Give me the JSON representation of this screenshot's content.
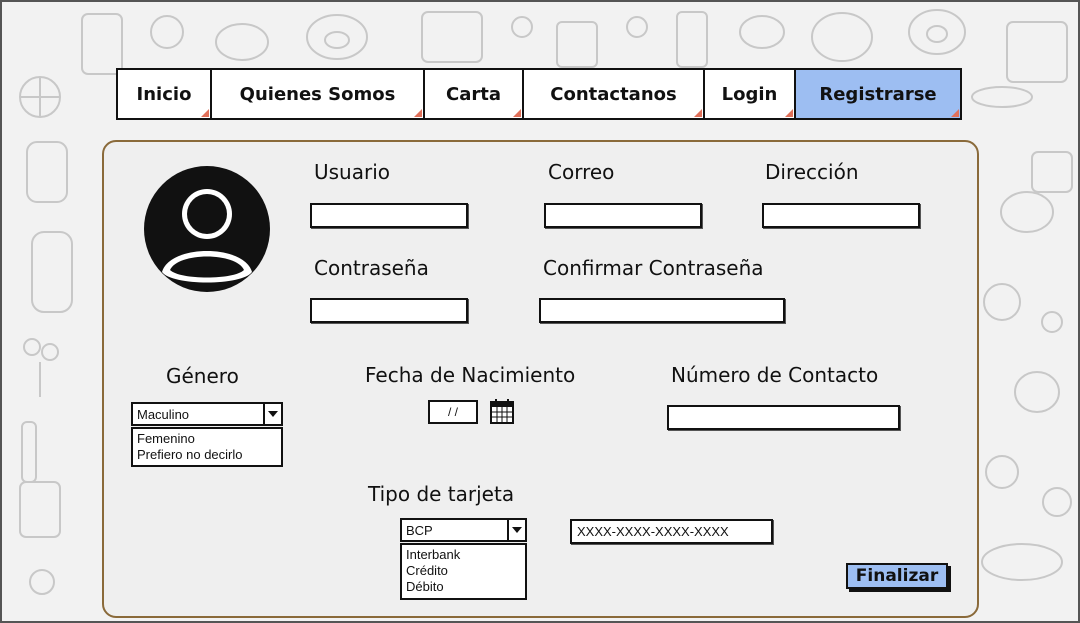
{
  "nav": {
    "items": [
      {
        "label": "Inicio"
      },
      {
        "label": "Quienes Somos"
      },
      {
        "label": "Carta"
      },
      {
        "label": "Contactanos"
      },
      {
        "label": "Login"
      },
      {
        "label": "Registrarse"
      }
    ],
    "active": "Registrarse"
  },
  "form": {
    "usuario_label": "Usuario",
    "correo_label": "Correo",
    "direccion_label": "Dirección",
    "contrasena_label": "Contraseña",
    "confirmar_label": "Confirmar Contraseña",
    "genero_label": "Género",
    "genero_selected": "Maculino",
    "genero_options": [
      "Femenino",
      "Prefiero no decirlo"
    ],
    "fecha_label": "Fecha de Nacimiento",
    "fecha_value": "/ /",
    "contacto_label": "Número de Contacto",
    "tarjeta_label": "Tipo de tarjeta",
    "tarjeta_selected": "BCP",
    "tarjeta_options": [
      "Interbank",
      "Crédito",
      "Débito"
    ],
    "tarjeta_number": "XXXX-XXXX-XXXX-XXXX",
    "finalizar_label": "Finalizar"
  },
  "colors": {
    "active_tab": "#9dbef2",
    "button": "#9dbef2",
    "panel_border": "#8a6a3a"
  }
}
